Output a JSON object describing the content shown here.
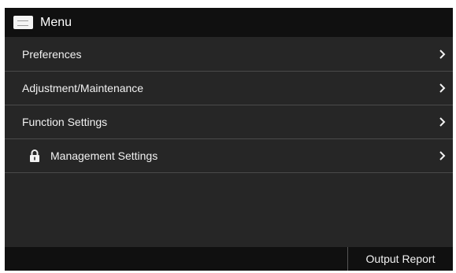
{
  "header": {
    "icon": "menu-icon",
    "title": "Menu"
  },
  "menu": {
    "items": [
      {
        "label": "Preferences",
        "icon": null
      },
      {
        "label": "Adjustment/Maintenance",
        "icon": null
      },
      {
        "label": "Function Settings",
        "icon": null
      },
      {
        "label": "Management Settings",
        "icon": "lock-icon"
      }
    ]
  },
  "footer": {
    "output_report_label": "Output Report"
  },
  "colors": {
    "screen_background": "#262626",
    "bar_background": "#101010",
    "text": "#f2f2f2",
    "divider": "#4a4a4a"
  }
}
